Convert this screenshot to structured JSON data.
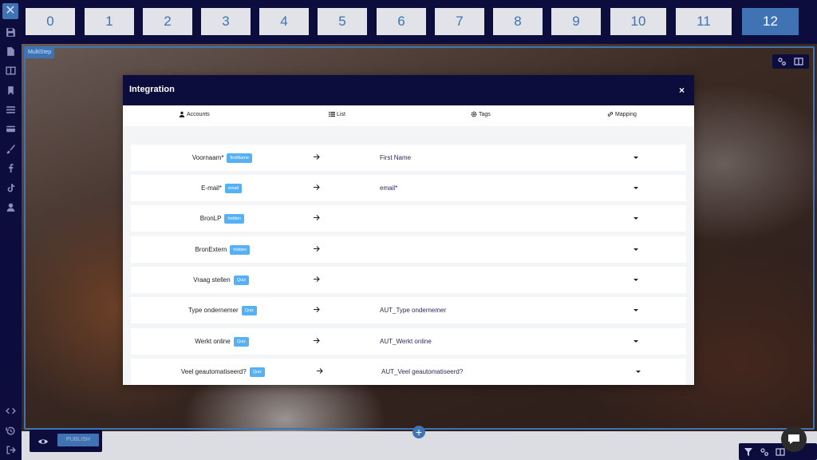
{
  "steps": [
    "0",
    "1",
    "2",
    "3",
    "4",
    "5",
    "6",
    "7",
    "8",
    "9",
    "10",
    "11",
    "12"
  ],
  "active_step": "12",
  "canvas": {
    "multistep_label": "MultiStep",
    "publish_label": "PUBLISH",
    "add_symbol": "+"
  },
  "modal": {
    "title": "Integration",
    "close_symbol": "×",
    "tabs": [
      {
        "label": "Accounts",
        "icon": "user-icon"
      },
      {
        "label": "List",
        "icon": "list-icon"
      },
      {
        "label": "Tags",
        "icon": "gear-icon"
      },
      {
        "label": "Mapping",
        "icon": "link-icon"
      }
    ],
    "rows": [
      {
        "field": "Voornaam*",
        "badge": "firstName",
        "value": "First Name"
      },
      {
        "field": "E-mail*",
        "badge": "email",
        "value": "email*"
      },
      {
        "field": "BronLP",
        "badge": "hidden",
        "value": ""
      },
      {
        "field": "BronExtern",
        "badge": "hidden",
        "value": ""
      },
      {
        "field": "Vraag stellen",
        "badge": "Quiz",
        "value": ""
      },
      {
        "field": "Type ondernemer",
        "badge": "Quiz",
        "value": "AUT_Type ondernemer"
      },
      {
        "field": "Werkt online",
        "badge": "Quiz",
        "value": "AUT_Werkt online"
      },
      {
        "field": "Veel geautomatiseerd?",
        "badge": "Quiz",
        "value": "AUT_Veel geautomatiseerd?"
      }
    ]
  },
  "colors": {
    "navy": "#0d0d3d",
    "accent": "#3f73b3",
    "badge": "#55b1f3"
  }
}
